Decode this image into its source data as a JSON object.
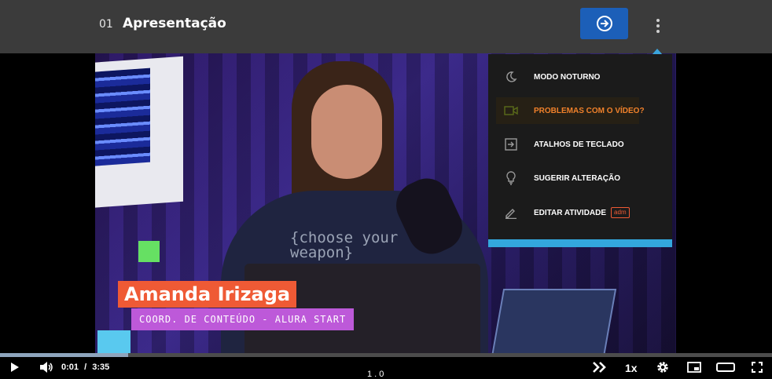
{
  "header": {
    "lesson_number": "01",
    "lesson_title": "Apresentação"
  },
  "video": {
    "presenter_name": "Amanda Irizaga",
    "presenter_role": "COORD. DE CONTEÚDO - ALURA START",
    "shirt_line1": "{choose your",
    "shirt_line2": " weapon}"
  },
  "menu": {
    "items": [
      {
        "label": "MODO NOTURNO",
        "icon": "moon-icon"
      },
      {
        "label": "PROBLEMAS COM O VÍDEO?",
        "icon": "video-camera-icon",
        "active": true
      },
      {
        "label": "ATALHOS DE TECLADO",
        "icon": "keyboard-shortcut-icon"
      },
      {
        "label": "SUGERIR ALTERAÇÃO",
        "icon": "lightbulb-icon"
      },
      {
        "label": "EDITAR ATIVIDADE",
        "icon": "pencil-icon",
        "badge": "adm"
      }
    ]
  },
  "player": {
    "current_time": "0:01",
    "separator": "/",
    "duration": "3:35",
    "speed": "1x",
    "progress_fraction": 0.166,
    "center_fragment": "1 . 0"
  },
  "colors": {
    "next_button": "#1c5fb8",
    "menu_accent": "#33a7dd",
    "active_item": "#f0812b",
    "name_tag": "#ef5a35",
    "role_tag": "#bd59d9"
  }
}
